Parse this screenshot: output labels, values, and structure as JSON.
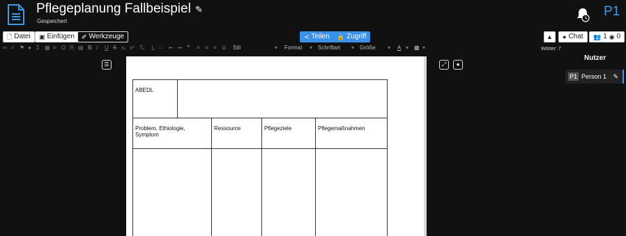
{
  "header": {
    "title": "Pflegeplanung Fallbeispiel",
    "subtitle": "Gespeichert",
    "user_initials": "P1"
  },
  "toolbar": {
    "file_label": "Datei",
    "insert_label": "Einfügen",
    "tools_label": "Werkzeuge",
    "share_label": "Teilen",
    "access_label": "Zugriff",
    "chat_label": "Chat",
    "users_count": "1",
    "viewers_count": "0"
  },
  "format_bar": {
    "style_label": "Stil",
    "format_label": "Format",
    "font_label": "Schriftart",
    "size_label": "Größe"
  },
  "status": {
    "words": "Wörter: 7"
  },
  "users_panel": {
    "title": "Nutzer",
    "users": [
      {
        "initials": "P1",
        "name": "Person 1"
      }
    ]
  },
  "document": {
    "table": {
      "header_label": "ABEDL",
      "columns": [
        "Problem, Ethiologie, Symptom",
        "Ressource",
        "Pflegeziele",
        "Pflegemaßnahmen"
      ]
    }
  },
  "colors": {
    "accent": "#3b91e8",
    "background": "#111111"
  }
}
